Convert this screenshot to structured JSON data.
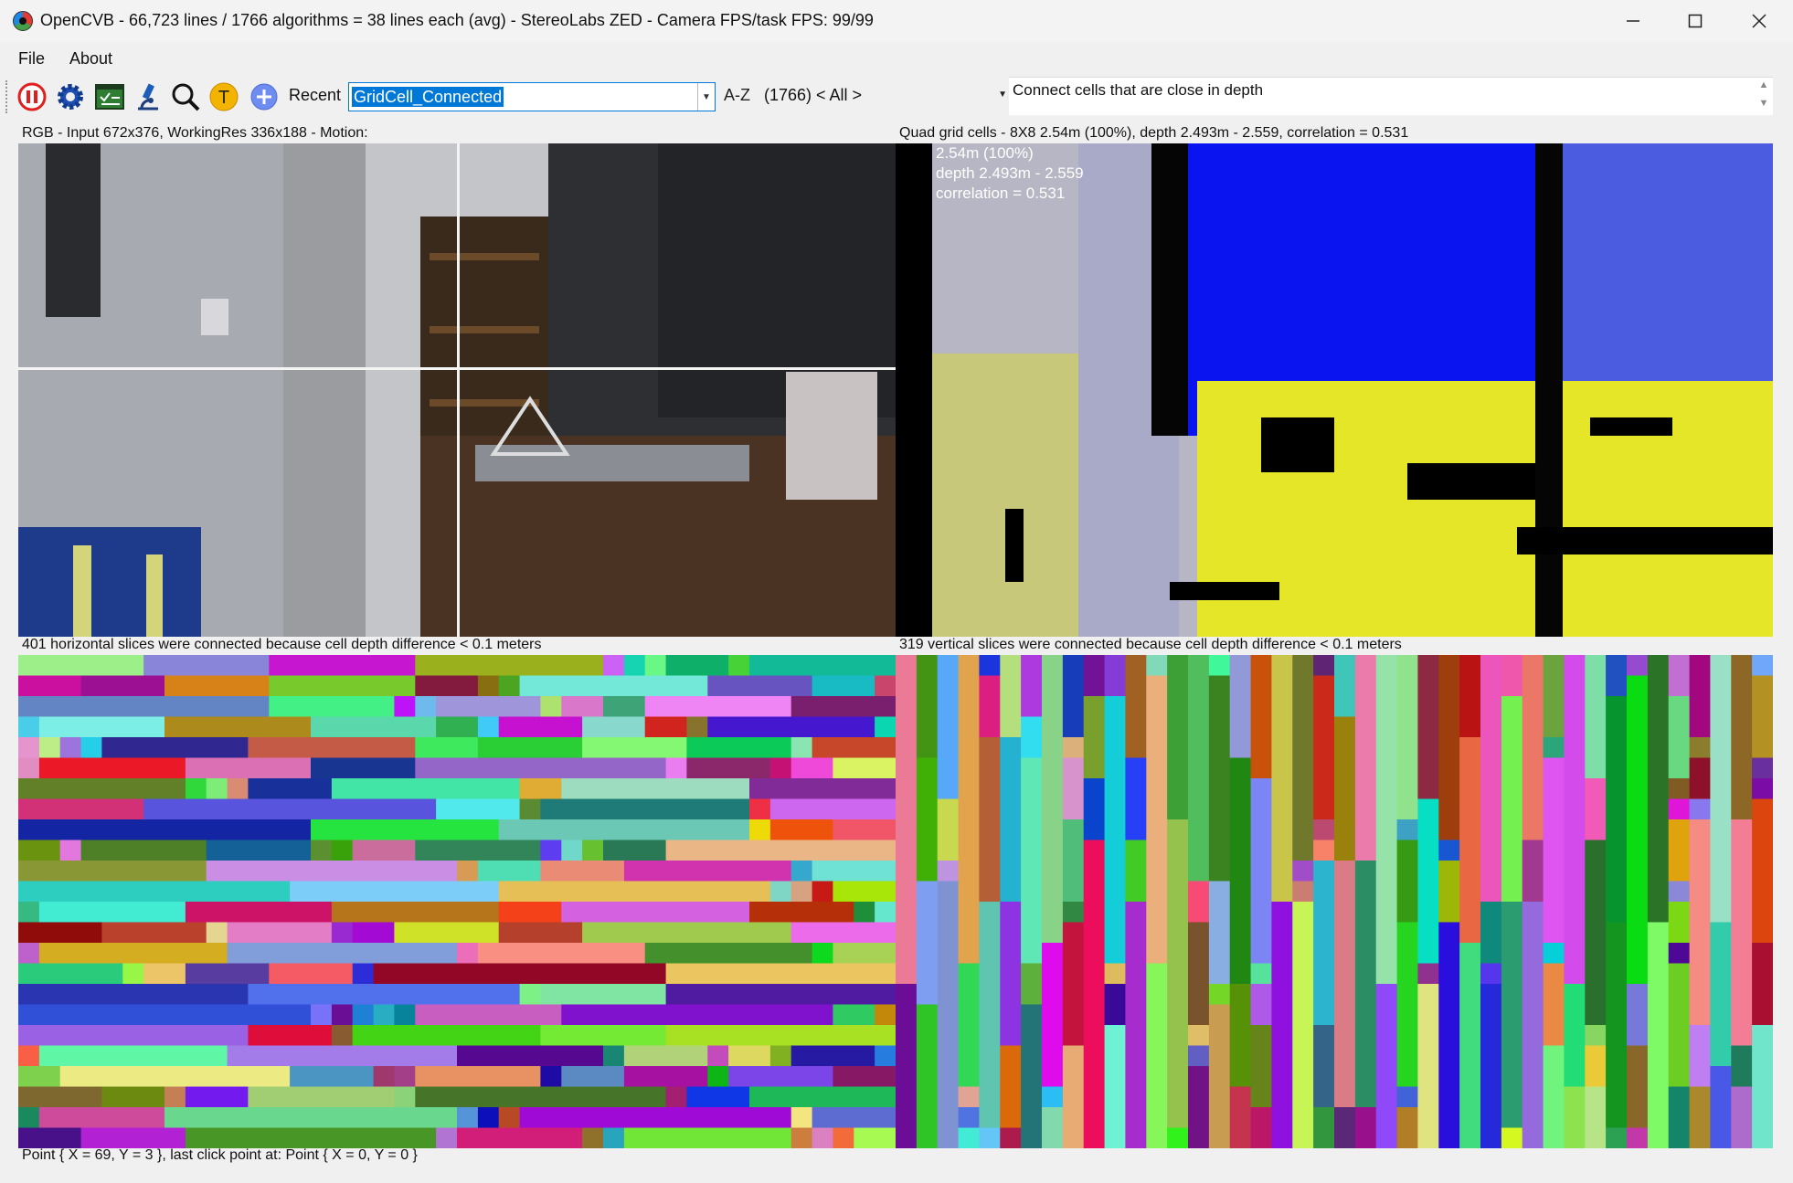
{
  "window": {
    "title": "OpenCVB - 66,723 lines / 1766 algorithms = 38 lines each (avg) - StereoLabs ZED - Camera FPS/task FPS: 99/99",
    "minimize_icon": "minimize-icon",
    "maximize_icon": "maximize-icon",
    "close_icon": "close-icon"
  },
  "menu": {
    "file": "File",
    "about": "About"
  },
  "toolbar": {
    "icons": [
      "pause-icon",
      "settings-gear-icon",
      "test-all-icon",
      "microscope-icon",
      "magnifier-icon",
      "translate-t-icon",
      "add-plus-icon"
    ],
    "recent_label": "Recent",
    "algorithm_value": "GridCell_Connected",
    "az_label": "A-Z",
    "group_value": "(1766) < All >",
    "description": "Connect cells that are close in depth"
  },
  "panels": {
    "rgb_caption": "RGB - Input 672x376, WorkingRes 336x188 - Motion:",
    "depth_caption": "Quad grid cells - 8X8  2.54m (100%), depth 2.493m - 2.559, correlation = 0.531",
    "depth_overlay": {
      "line1": "2.54m (100%)",
      "line2": "depth 2.493m - 2.559",
      "line3": "correlation = 0.531"
    },
    "horizontal_caption": "401 horizontal slices were connected because cell depth difference < 0.1 meters",
    "vertical_caption": "319 vertical slices were connected because cell depth difference < 0.1 meters"
  },
  "status": {
    "text": "Point { X = 69, Y = 3 }, last click point at: Point { X = 0, Y = 0 }"
  },
  "colors": {
    "accent": "#0078d7",
    "depth_blue": "#0a14f0",
    "depth_yellow": "#e6e628",
    "pause_red": "#e02020"
  }
}
